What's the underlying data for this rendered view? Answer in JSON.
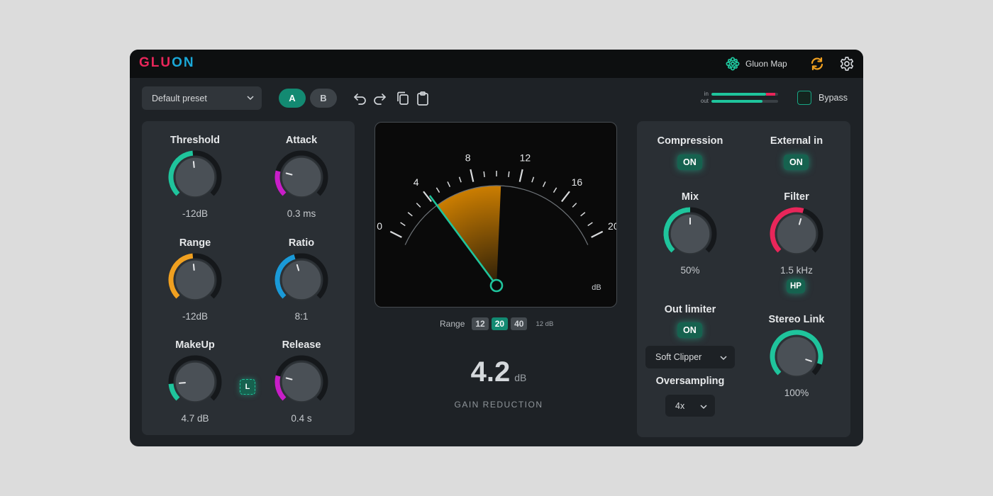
{
  "app": {
    "logo_part1": "GLU",
    "logo_part2": "ON",
    "map_label": "Gluon Map"
  },
  "icons": {
    "map": "flower-node-icon",
    "sync": "sync-icon",
    "settings": "gear-icon",
    "undo": "undo-icon",
    "redo": "redo-icon",
    "copy": "copy-icon",
    "paste": "clipboard-icon",
    "dropdown": "chevron-down-icon"
  },
  "colors": {
    "accent": "#1fc49c",
    "accent_dark": "#138a72",
    "brand_red": "#e8265a",
    "brand_blue": "#1aa8d8",
    "orange": "#f0a020",
    "purple": "#c81ec8",
    "blue": "#1a9ad8",
    "needle": "#1fc49c",
    "gain_fan": "#e08a00"
  },
  "toolbar": {
    "preset": "Default preset",
    "a_label": "A",
    "b_label": "B",
    "meter_in_label": "in",
    "meter_out_label": "out",
    "meter_in_level": 0.82,
    "meter_in_peak": 0.14,
    "meter_out_level": 0.77,
    "bypass_label": "Bypass",
    "bypass_on": false
  },
  "left_knobs": [
    {
      "title": "Threshold",
      "value": "-12dB",
      "fill": 0.48,
      "color": "#1fc49c"
    },
    {
      "title": "Attack",
      "value": "0.3 ms",
      "fill": 0.22,
      "color": "#c81ec8"
    },
    {
      "title": "Range",
      "value": "-12dB",
      "fill": 0.48,
      "color": "#f0a020"
    },
    {
      "title": "Ratio",
      "value": "8:1",
      "fill": 0.44,
      "color": "#1a9ad8"
    },
    {
      "title": "MakeUp",
      "value": "4.7 dB",
      "fill": 0.15,
      "color": "#1fc49c"
    },
    {
      "title": "Release",
      "value": "0.4 s",
      "fill": 0.22,
      "color": "#c81ec8"
    }
  ],
  "makeup_link": "L",
  "meter": {
    "scale_labels": [
      "0",
      "4",
      "8",
      "12",
      "16",
      "20"
    ],
    "unit": "dB",
    "gain_reduction": 4.2,
    "fan_start": 4.2,
    "fan_end": 10.4,
    "scale_max": 20
  },
  "range": {
    "label": "Range",
    "options": [
      "12",
      "20",
      "40"
    ],
    "selected": "20",
    "unit": "12 dB"
  },
  "gain_reduction": {
    "value": "4.2",
    "unit": "dB",
    "label": "GAIN REDUCTION"
  },
  "right": {
    "compression_title": "Compression",
    "compression_state": "ON",
    "external_title": "External in",
    "external_state": "ON",
    "mix": {
      "title": "Mix",
      "value": "50%",
      "fill": 0.5,
      "color": "#1fc49c"
    },
    "filter": {
      "title": "Filter",
      "value": "1.5 kHz",
      "fill": 0.56,
      "color": "#e8265a"
    },
    "filter_mode": "HP",
    "limiter_title": "Out limiter",
    "limiter_state": "ON",
    "clipper": "Soft Clipper",
    "oversampling_title": "Oversampling",
    "oversampling": "4x",
    "stereo": {
      "title": "Stereo Link",
      "value": "100%",
      "fill": 0.9,
      "color": "#1fc49c"
    }
  }
}
